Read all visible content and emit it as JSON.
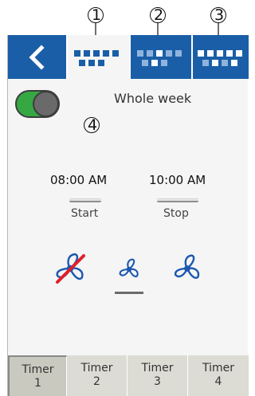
{
  "callouts": [
    "1",
    "2",
    "3",
    "4"
  ],
  "header": {
    "back_icon": "chevron-left-icon",
    "tabs": [
      {
        "icon": "week-grid-icon",
        "active": true
      },
      {
        "icon": "week-grid-icon",
        "active": false
      },
      {
        "icon": "week-grid-icon",
        "active": false
      }
    ]
  },
  "schedule": {
    "toggle_on": true,
    "mode_label": "Whole week",
    "start_time": "08:00 AM",
    "stop_time": "10:00 AM",
    "start_label": "Start",
    "stop_label": "Stop"
  },
  "fan_speeds": {
    "options": [
      "fan-off-icon",
      "fan-low-icon",
      "fan-high-icon"
    ],
    "selected": 1
  },
  "footer": {
    "timers": [
      {
        "line1": "Timer",
        "line2": "1"
      },
      {
        "line1": "Timer",
        "line2": "2"
      },
      {
        "line1": "Timer",
        "line2": "3"
      },
      {
        "line1": "Timer",
        "line2": "4"
      }
    ],
    "active_index": 0
  },
  "colors": {
    "header_blue": "#1a5ea8",
    "toggle_green": "#35a844",
    "fan_blue": "#1c57b0",
    "off_red": "#e0202a"
  }
}
